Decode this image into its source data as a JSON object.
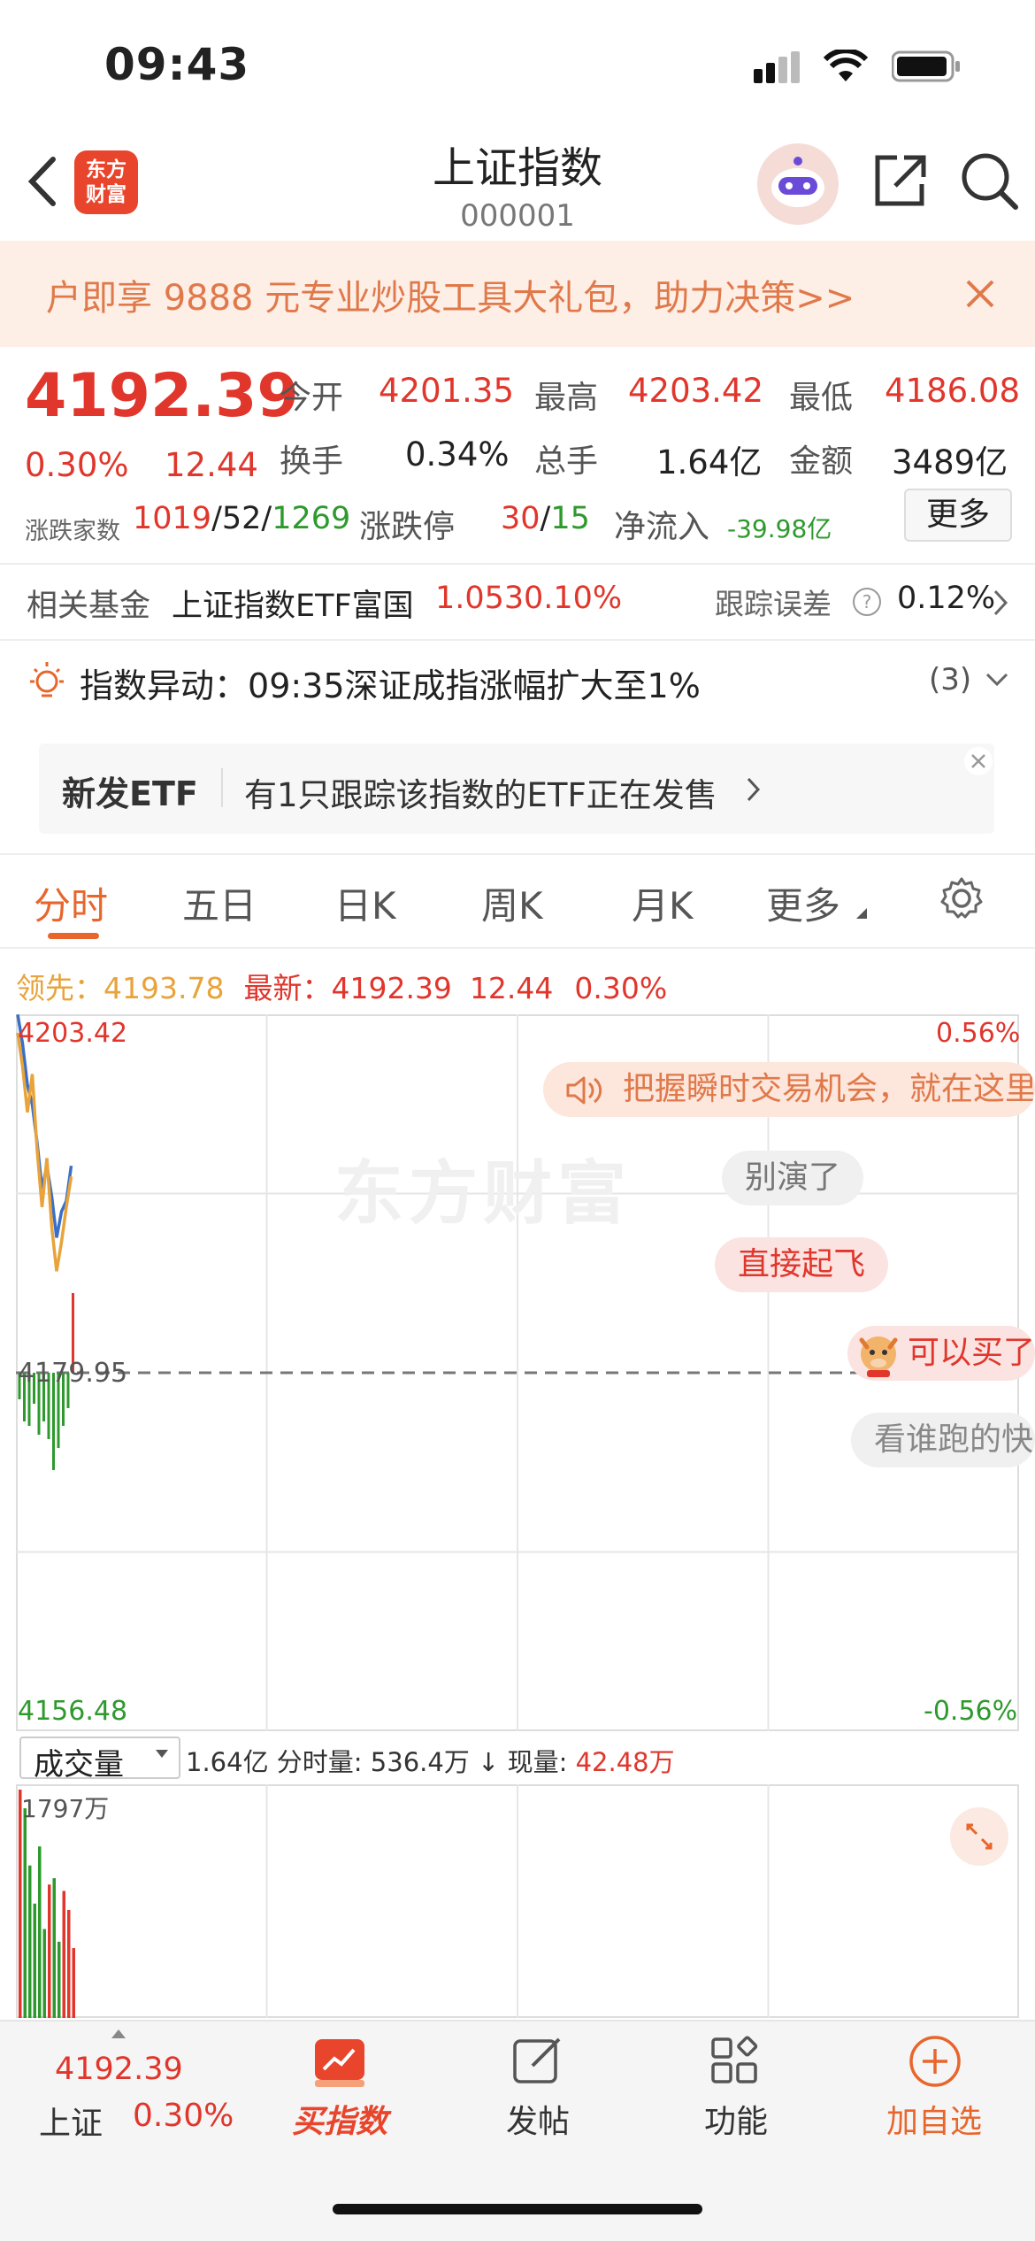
{
  "status": {
    "time": "09:43"
  },
  "header": {
    "logo_line1": "东方",
    "logo_line2": "财富",
    "title": "上证指数",
    "code": "000001"
  },
  "banner": {
    "text": "户即享 9888 元专业炒股工具大礼包，助力决策>>"
  },
  "quote": {
    "price": "4192.39",
    "change_pct": "0.30%",
    "change_abs": "12.44",
    "open_label": "今开",
    "open": "4201.35",
    "high_label": "最高",
    "high": "4203.42",
    "low_label": "最低",
    "low": "4186.08",
    "turnover_label": "换手",
    "turnover": "0.34%",
    "volume_label": "总手",
    "volume": "1.64亿",
    "amount_label": "金额",
    "amount": "3489亿",
    "breadth_label": "涨跌家数",
    "breadth_up": "1019",
    "breadth_flat": "52",
    "breadth_down": "1269",
    "limit_label": "涨跌停",
    "limit_up": "30",
    "limit_down": "15",
    "netflow_label": "净流入",
    "netflow": "-39.98亿",
    "more": "更多"
  },
  "fund": {
    "label": "相关基金",
    "name": "上证指数ETF富国",
    "price": "1.053",
    "pct": "0.10%",
    "tracking_label": "跟踪误差",
    "tracking": "0.12%"
  },
  "alert": {
    "label": "指数异动：",
    "text": "09:35深证成指涨幅扩大至1%",
    "count": "(3)"
  },
  "etf_card": {
    "tag": "新发ETF",
    "text": "有1只跟踪该指数的ETF正在发售"
  },
  "tabs": [
    "分时",
    "五日",
    "日K",
    "周K",
    "月K",
    "更多"
  ],
  "chart_info": {
    "lead_label": "领先：",
    "lead": "4193.78",
    "latest_label": "最新：",
    "latest": "4192.39",
    "change": "12.44",
    "pct": "0.30%",
    "top_price": "4203.42",
    "top_pct": "0.56%",
    "mid_price": "4179.95",
    "bottom_price": "4156.48",
    "bottom_pct": "-0.56%",
    "watermark": "东方财富"
  },
  "danmaku": {
    "promo": "把握瞬时交易机会，就在这里",
    "c1": "别演了",
    "c2": "直接起飞",
    "c3": "可以买了",
    "c4": "看谁跑的快"
  },
  "volume": {
    "selector": "成交量",
    "total": "1.64亿",
    "fenshi_label": "分时量:",
    "fenshi": "536.4万",
    "arrow": "↓",
    "now_label": "现量:",
    "now": "42.48万",
    "max_label": "1797万"
  },
  "chart_data": {
    "type": "line",
    "series": [
      {
        "values": [
          4203.4,
          4201.5,
          4198.8,
          4197.5,
          4195.0,
          4192.0,
          4193.5,
          4191.5,
          4188.8,
          4190.5,
          4191.2,
          4193.5
        ]
      },
      {
        "values": [
          4202.2,
          4200.0,
          4197.0,
          4199.5,
          4194.5,
          4190.8,
          4194.0,
          4189.5,
          4186.6,
          4188.5,
          4190.8,
          4192.8
        ]
      }
    ],
    "ylim": [
      4156.48,
      4203.42
    ],
    "reference": 4179.95,
    "volume_values": [
      1797,
      1650,
      1200,
      900,
      1350,
      700,
      1050,
      1100,
      600,
      1000,
      850,
      550
    ],
    "colors": {
      "line1": "#3a6fc8",
      "line2": "#e8a33a",
      "up": "#e0362c",
      "down": "#2e9a2e"
    }
  },
  "bottom_nav": {
    "price": "4192.39",
    "name": "上证",
    "pct": "0.30%",
    "buy": "买指数",
    "post": "发帖",
    "func": "功能",
    "add": "加自选"
  }
}
